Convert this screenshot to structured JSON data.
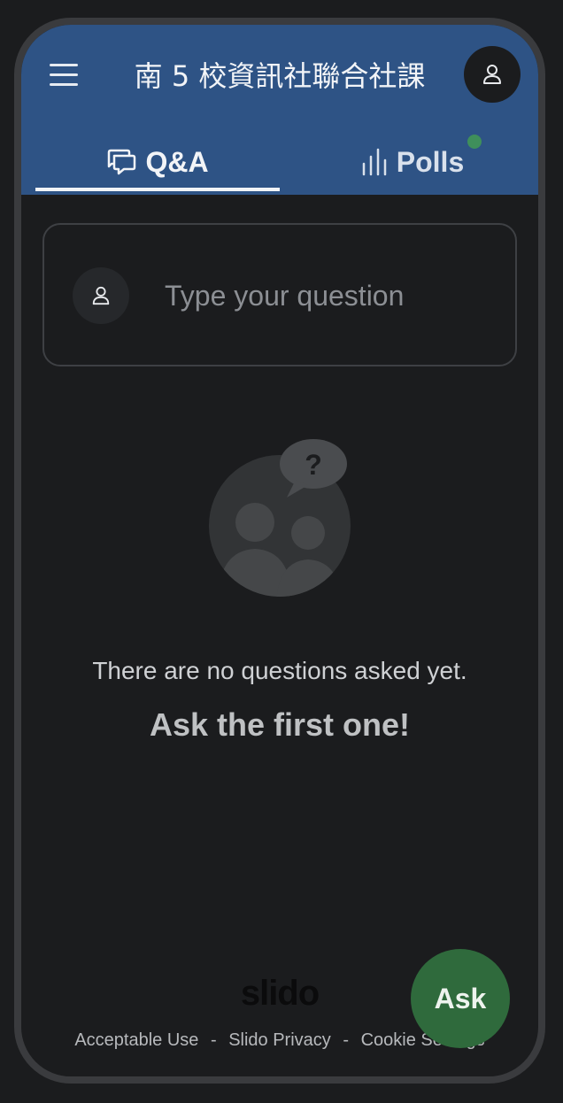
{
  "header": {
    "title": "南 5 校資訊社聯合社課",
    "menu_icon": "hamburger-menu-icon",
    "profile_icon": "user-icon"
  },
  "tabs": [
    {
      "label": "Q&A",
      "icon": "chat-bubbles-icon",
      "active": true
    },
    {
      "label": "Polls",
      "icon": "bar-chart-icon",
      "active": false,
      "has_notification": true
    }
  ],
  "question_input": {
    "placeholder": "Type your question",
    "avatar_icon": "user-icon"
  },
  "empty_state": {
    "illustration_icon": "people-question-icon",
    "line1": "There are no questions asked yet.",
    "line2": "Ask the first one!"
  },
  "footer": {
    "logo": "slido",
    "links": [
      "Acceptable Use",
      "Slido Privacy",
      "Cookie Settings"
    ],
    "separator": "-"
  },
  "ask_button": {
    "label": "Ask"
  },
  "colors": {
    "header_bg": "#2e5385",
    "page_bg": "#1b1c1e",
    "ask_button_bg": "#2f6a3c",
    "notification_dot": "#3f8f5b"
  }
}
